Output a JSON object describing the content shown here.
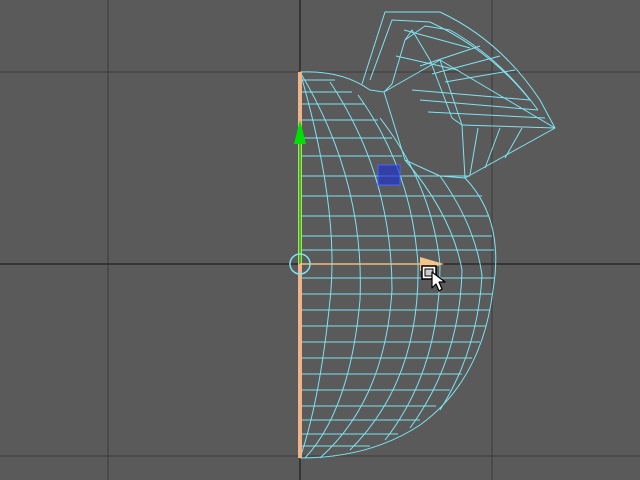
{
  "viewport": {
    "background": "#5a5a5a",
    "grid_color": "#3a3a3a",
    "wire_color": "#7fe3f0",
    "axis_y_color": "#00e000",
    "axis_x_color": "#f2c48a",
    "edge_selected_color": "#f0b48a",
    "face_selected_color": "#1f2fd0"
  },
  "cursor": {
    "icon": "move-cursor-icon"
  }
}
